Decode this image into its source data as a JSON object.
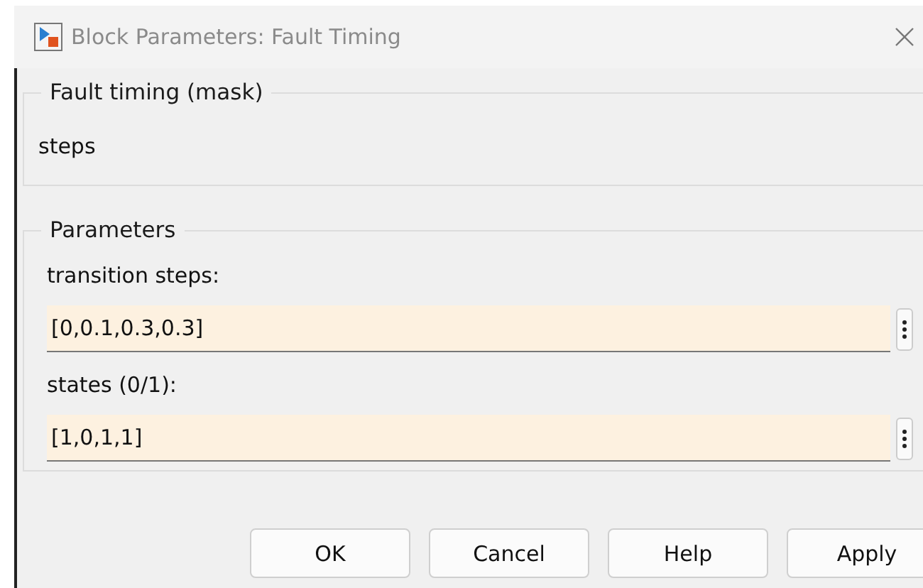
{
  "window": {
    "title": "Block Parameters: Fault Timing"
  },
  "description_group": {
    "title": "Fault timing (mask)",
    "text": "steps"
  },
  "parameters_group": {
    "title": "Parameters",
    "fields": [
      {
        "label": "transition steps:",
        "value": "[0,0.1,0.3,0.3]"
      },
      {
        "label": "states (0/1):",
        "value": "[1,0,1,1]"
      }
    ]
  },
  "buttons": [
    "OK",
    "Cancel",
    "Help",
    "Apply"
  ]
}
